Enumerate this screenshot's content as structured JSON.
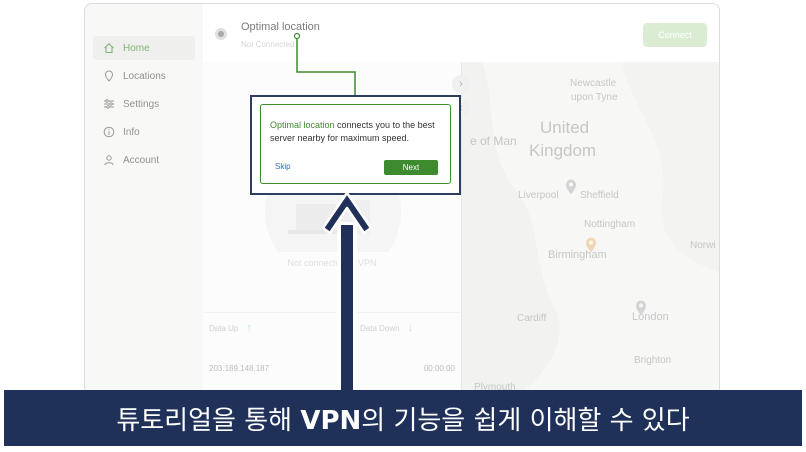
{
  "sidebar": {
    "items": [
      {
        "label": "Home",
        "icon": "home-icon",
        "active": true
      },
      {
        "label": "Locations",
        "icon": "location-pin-icon",
        "active": false
      },
      {
        "label": "Settings",
        "icon": "sliders-icon",
        "active": false
      },
      {
        "label": "Info",
        "icon": "info-icon",
        "active": false
      },
      {
        "label": "Account",
        "icon": "user-icon",
        "active": false
      }
    ]
  },
  "header": {
    "title": "Optimal location",
    "subtitle": "Not Connected",
    "connect_label": "Connect"
  },
  "main": {
    "status_text": "Not connected to VPN",
    "data_up_label": "Data Up",
    "data_down_label": "Data Down",
    "ip_address": "203.189.148.187",
    "timer": "00:00:00"
  },
  "map": {
    "labels": {
      "newcastle": "Newcastle",
      "upon_tyne": "upon Tyne",
      "united": "United",
      "kingdom": "Kingdom",
      "isle_of_man": "e of Man",
      "liverpool": "Liverpool",
      "sheffield": "Sheffield",
      "nottingham": "Nottingham",
      "birmingham": "Birmingham",
      "norwich": "Norwi",
      "cardiff": "Cardiff",
      "london": "London",
      "brighton": "Brighton",
      "plymouth": "Plymouth"
    }
  },
  "tooltip": {
    "highlight": "Optimal location",
    "text": " connects you to the best server nearby for maximum speed.",
    "skip_label": "Skip",
    "next_label": "Next"
  },
  "caption": {
    "part1": "튜토리얼을 통해 ",
    "bold": "VPN",
    "part2": "의 기능을 쉽게 이해할 수 있다"
  },
  "colors": {
    "accent": "#3e8a2e",
    "banner": "#1f3159",
    "connect_disabled": "#c6e4bc"
  }
}
